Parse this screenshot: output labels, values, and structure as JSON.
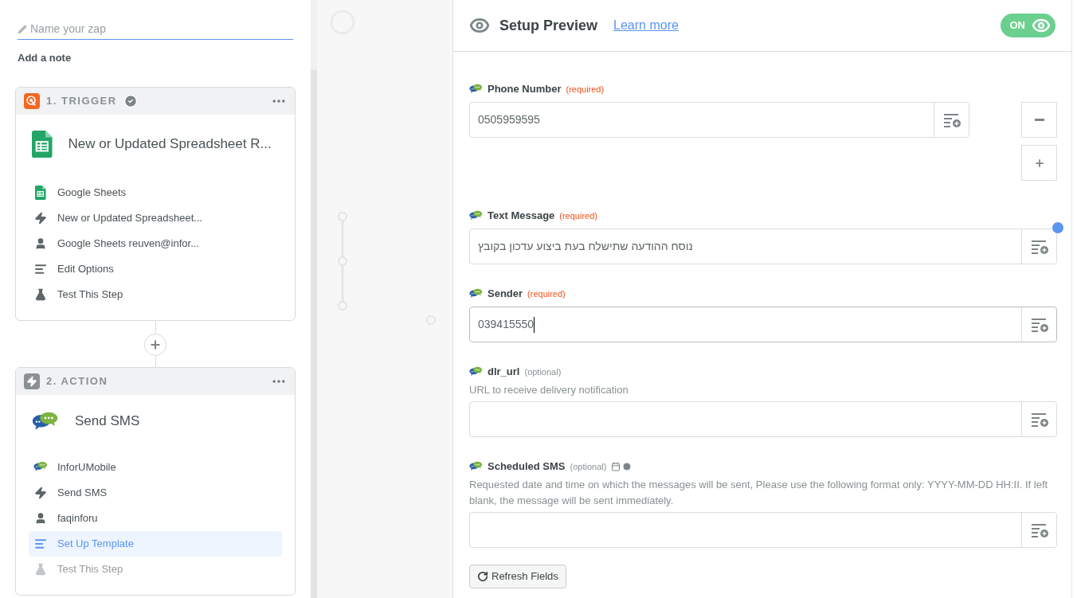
{
  "zap_name": {
    "placeholder": "Name your zap"
  },
  "add_note": "Add a note",
  "steps": [
    {
      "number_label": "1. TRIGGER",
      "kind": "trigger",
      "done": true,
      "title": "New or Updated Spreadsheet R...",
      "items": [
        {
          "kind": "app",
          "label": "Google Sheets",
          "selected": false,
          "disabled": false
        },
        {
          "kind": "event",
          "label": "New or Updated Spreadsheet...",
          "selected": false,
          "disabled": false
        },
        {
          "kind": "account",
          "label": "Google Sheets reuven@infor...",
          "selected": false,
          "disabled": false
        },
        {
          "kind": "options",
          "label": "Edit Options",
          "selected": false,
          "disabled": false
        },
        {
          "kind": "test",
          "label": "Test This Step",
          "selected": false,
          "disabled": false
        }
      ]
    },
    {
      "number_label": "2. ACTION",
      "kind": "action",
      "done": false,
      "title": "Send SMS",
      "items": [
        {
          "kind": "app",
          "label": "InforUMobile",
          "selected": false,
          "disabled": false
        },
        {
          "kind": "event",
          "label": "Send SMS",
          "selected": false,
          "disabled": false
        },
        {
          "kind": "account",
          "label": "faqinforu",
          "selected": false,
          "disabled": false
        },
        {
          "kind": "options",
          "label": "Set Up Template",
          "selected": true,
          "disabled": false
        },
        {
          "kind": "test",
          "label": "Test This Step",
          "selected": false,
          "disabled": true
        }
      ]
    }
  ],
  "preview": {
    "title": "Setup Preview",
    "link": "Learn more",
    "toggle": {
      "label": "ON",
      "on": true
    }
  },
  "fields": [
    {
      "kind": "list",
      "label": "Phone Number",
      "requirement": "(required)",
      "required": true,
      "value": "0505959595",
      "focused": false
    },
    {
      "kind": "text",
      "label": "Text Message",
      "requirement": "(required)",
      "required": true,
      "value": "נוסח ההודעה שתישלח בעת ביצוע עדכון בקובץ",
      "focused": false,
      "notify": true
    },
    {
      "kind": "text",
      "label": "Sender",
      "requirement": "(required)",
      "required": true,
      "value": "039415550",
      "focused": true
    },
    {
      "kind": "text",
      "label": "dlr_url",
      "requirement": "(optional)",
      "required": false,
      "help": "URL to receive delivery notification",
      "focused": false
    },
    {
      "kind": "text",
      "label": "Scheduled SMS",
      "requirement": "(optional)",
      "required": false,
      "help": "Requested date and time on which the messages will be sent, Please use the following format only: YYYY-MM-DD HH:II. If left blank, the message will be sent immediately.",
      "focused": false,
      "datetime": true
    }
  ],
  "refresh_button": "Refresh Fields"
}
